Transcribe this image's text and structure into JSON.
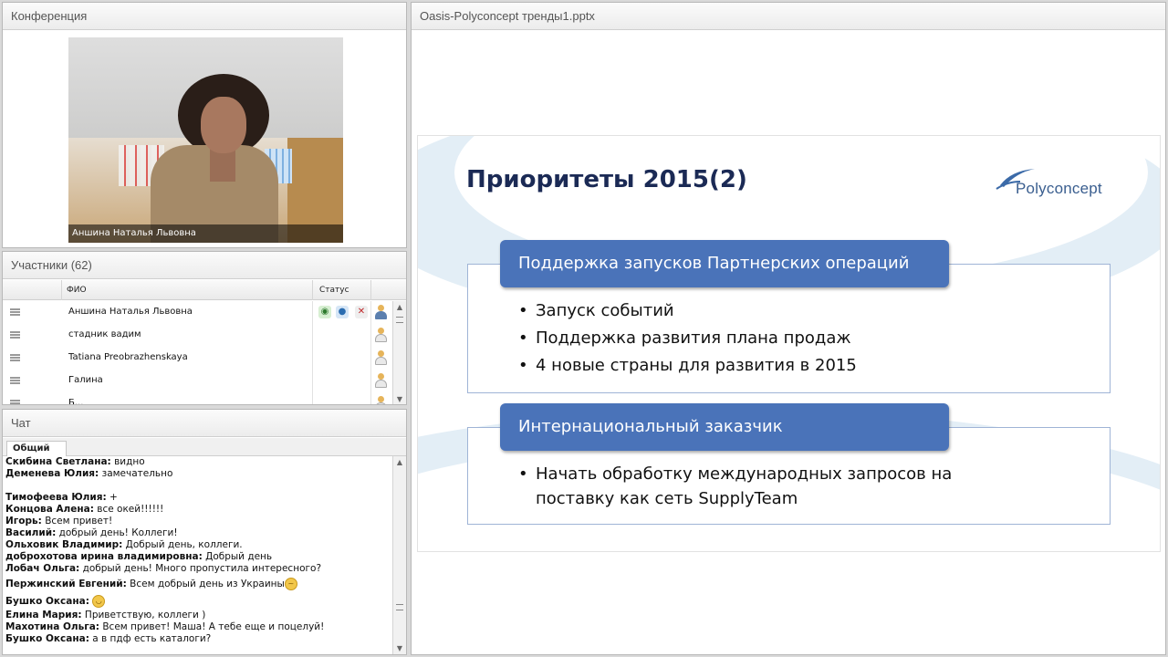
{
  "video_panel": {
    "title": "Конференция",
    "caption": "Аншина Наталья Львовна"
  },
  "participants_panel": {
    "title": "Участники (62)",
    "columns": [
      "ФИО",
      "Статус"
    ],
    "rows": [
      {
        "name": "Аншина Наталья Львовна"
      },
      {
        "name": "стадник вадим"
      },
      {
        "name": "Tatiana Preobrazhenskaya"
      },
      {
        "name": "Галина"
      },
      {
        "name": "Б..."
      }
    ],
    "icons": {
      "status_1": "webcam-icon",
      "status_2": "microphone-icon",
      "status_3": "no-video-icon",
      "user": "user-icon"
    }
  },
  "chat_panel": {
    "title": "Чат",
    "tab": "Общий",
    "messages": [
      {
        "author": "Скибина  Светлана:",
        "text": "видно"
      },
      {
        "author": "Деменева Юлия:",
        "text": "замечательно"
      },
      {
        "author": "Тимофеева Юлия:",
        "text": "+"
      },
      {
        "author": "Концова Алена:",
        "text": "все окей!!!!!!"
      },
      {
        "author": "Игорь:",
        "text": "Всем привет!"
      },
      {
        "author": "Василий:",
        "text": "добрый день! Коллеги!"
      },
      {
        "author": "Ольховик Владимир:",
        "text": "Добрый день, коллеги."
      },
      {
        "author": "доброхотова ирина  владимировна:",
        "text": "Добрый день"
      },
      {
        "author": "Лобач Ольга:",
        "text": "добрый день! Много пропустила интересного?"
      },
      {
        "author": "Пержинский Евгений:",
        "text": "Всем добрый день из Украины"
      },
      {
        "author": "Бушко Оксана:",
        "text": ""
      },
      {
        "author": "Елина Мария:",
        "text": "Приветствую, коллеги )"
      },
      {
        "author": "Махотина Ольга:",
        "text": "Всем привет! Маша! А тебе еще и поцелуй!"
      },
      {
        "author": "Бушко Оксана:",
        "text": "а в пдф есть каталоги?"
      }
    ]
  },
  "presentation_panel": {
    "title": "Oasis-Polyconcept тренды1.pptx",
    "slide": {
      "title": "Приоритеты 2015(2)",
      "logo_text": "Polyconcept",
      "section1": {
        "header": "Поддержка запусков Партнерских операций",
        "bullets": [
          "Запуск событий",
          "Поддержка развития плана продаж",
          "4 новые страны для развития в 2015"
        ]
      },
      "section2": {
        "header": "Интернациональный заказчик",
        "bullet_line1": "Начать обработку международных запросов на",
        "bullet_line2": "поставку  как сеть SupplyTeam"
      }
    },
    "colors": {
      "header_bg": "#4a73b9",
      "title": "#1b2a55",
      "border": "#9fb4d6"
    }
  }
}
